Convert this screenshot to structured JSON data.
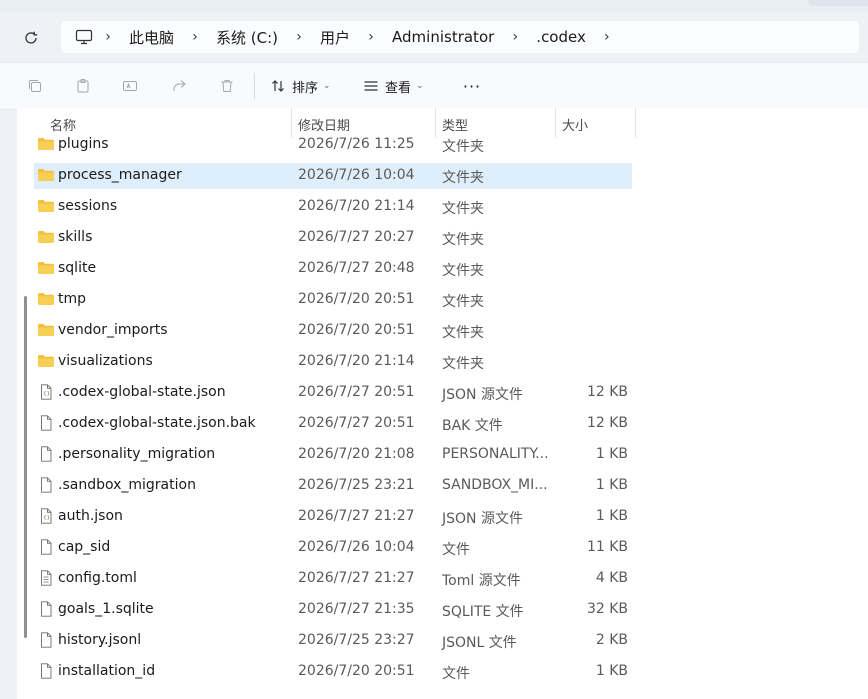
{
  "breadcrumb": [
    "此电脑",
    "系统 (C:)",
    "用户",
    "Administrator",
    ".codex"
  ],
  "toolbar": {
    "sort_label": "排序",
    "view_label": "查看",
    "more_label": "···"
  },
  "columns": {
    "name": "名称",
    "date": "修改日期",
    "type": "类型",
    "size": "大小"
  },
  "files": [
    {
      "name": "plugins",
      "date": "2026/7/26 11:25",
      "type": "文件夹",
      "size": "",
      "icon": "folder-icon"
    },
    {
      "name": "process_manager",
      "date": "2026/7/26 10:04",
      "type": "文件夹",
      "size": "",
      "icon": "folder-icon",
      "selected": true
    },
    {
      "name": "sessions",
      "date": "2026/7/20 21:14",
      "type": "文件夹",
      "size": "",
      "icon": "folder-icon"
    },
    {
      "name": "skills",
      "date": "2026/7/27 20:27",
      "type": "文件夹",
      "size": "",
      "icon": "folder-icon"
    },
    {
      "name": "sqlite",
      "date": "2026/7/27 20:48",
      "type": "文件夹",
      "size": "",
      "icon": "folder-icon"
    },
    {
      "name": "tmp",
      "date": "2026/7/20 20:51",
      "type": "文件夹",
      "size": "",
      "icon": "folder-icon"
    },
    {
      "name": "vendor_imports",
      "date": "2026/7/20 20:51",
      "type": "文件夹",
      "size": "",
      "icon": "folder-icon"
    },
    {
      "name": "visualizations",
      "date": "2026/7/20 21:14",
      "type": "文件夹",
      "size": "",
      "icon": "folder-icon"
    },
    {
      "name": ".codex-global-state.json",
      "date": "2026/7/27 20:51",
      "type": "JSON 源文件",
      "size": "12 KB",
      "icon": "json-file-icon"
    },
    {
      "name": ".codex-global-state.json.bak",
      "date": "2026/7/27 20:51",
      "type": "BAK 文件",
      "size": "12 KB",
      "icon": "file-icon"
    },
    {
      "name": ".personality_migration",
      "date": "2026/7/20 21:08",
      "type": "PERSONALITY...",
      "size": "1 KB",
      "icon": "file-icon"
    },
    {
      "name": ".sandbox_migration",
      "date": "2026/7/25 23:21",
      "type": "SANDBOX_MI...",
      "size": "1 KB",
      "icon": "file-icon"
    },
    {
      "name": "auth.json",
      "date": "2026/7/27 21:27",
      "type": "JSON 源文件",
      "size": "1 KB",
      "icon": "json-file-icon"
    },
    {
      "name": "cap_sid",
      "date": "2026/7/26 10:04",
      "type": "文件",
      "size": "11 KB",
      "icon": "file-icon"
    },
    {
      "name": "config.toml",
      "date": "2026/7/27 21:27",
      "type": "Toml 源文件",
      "size": "4 KB",
      "icon": "text-file-icon"
    },
    {
      "name": "goals_1.sqlite",
      "date": "2026/7/27 21:35",
      "type": "SQLITE 文件",
      "size": "32 KB",
      "icon": "file-icon"
    },
    {
      "name": "history.jsonl",
      "date": "2026/7/25 23:27",
      "type": "JSONL 文件",
      "size": "2 KB",
      "icon": "file-icon"
    },
    {
      "name": "installation_id",
      "date": "2026/7/20 20:51",
      "type": "文件",
      "size": "1 KB",
      "icon": "file-icon"
    }
  ],
  "colors": {
    "folder": "#f6c343",
    "selected": "#dfeefb",
    "accent": "#0067c0"
  }
}
